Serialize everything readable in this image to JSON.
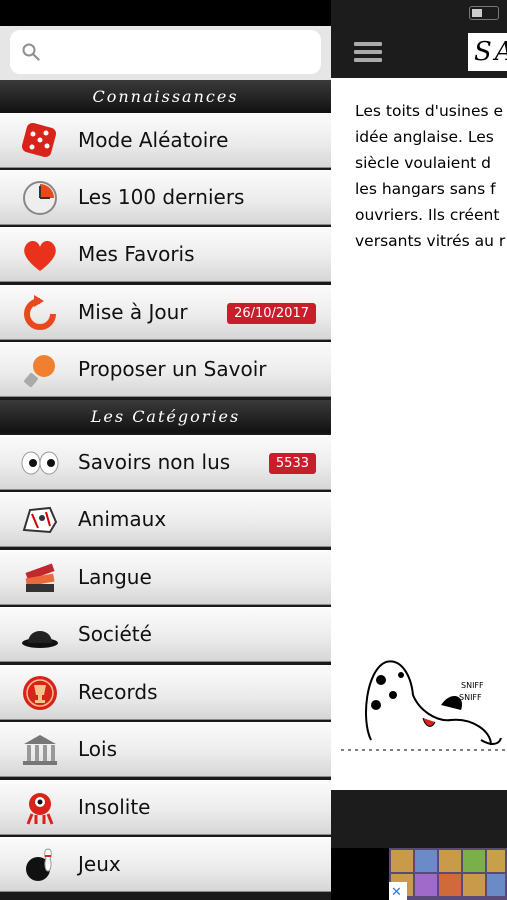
{
  "search": {
    "placeholder": ""
  },
  "sections": {
    "knowledge": "Connaissances",
    "categories": "Les Catégories"
  },
  "menu": {
    "random": {
      "label": "Mode Aléatoire"
    },
    "last100": {
      "label": "Les 100 derniers"
    },
    "favorites": {
      "label": "Mes Favoris"
    },
    "update": {
      "label": "Mise à Jour",
      "badge": "26/10/2017"
    },
    "propose": {
      "label": "Proposer un Savoir"
    },
    "unread": {
      "label": "Savoirs non lus",
      "badge": "5533"
    },
    "animals": {
      "label": "Animaux"
    },
    "language": {
      "label": "Langue"
    },
    "society": {
      "label": "Société"
    },
    "records": {
      "label": "Records"
    },
    "laws": {
      "label": "Lois"
    },
    "unusual": {
      "label": "Insolite"
    },
    "games": {
      "label": "Jeux"
    }
  },
  "content": {
    "logo": "SA",
    "lines": [
      "Les toits d'usines e",
      "idée anglaise. Les",
      "siècle voulaient d",
      "les hangars sans f",
      "ouvriers. Ils créent",
      "versants vitrés au r"
    ]
  },
  "colors": {
    "badge": "#c81e2b",
    "section_bg": "#1a1a1a"
  }
}
